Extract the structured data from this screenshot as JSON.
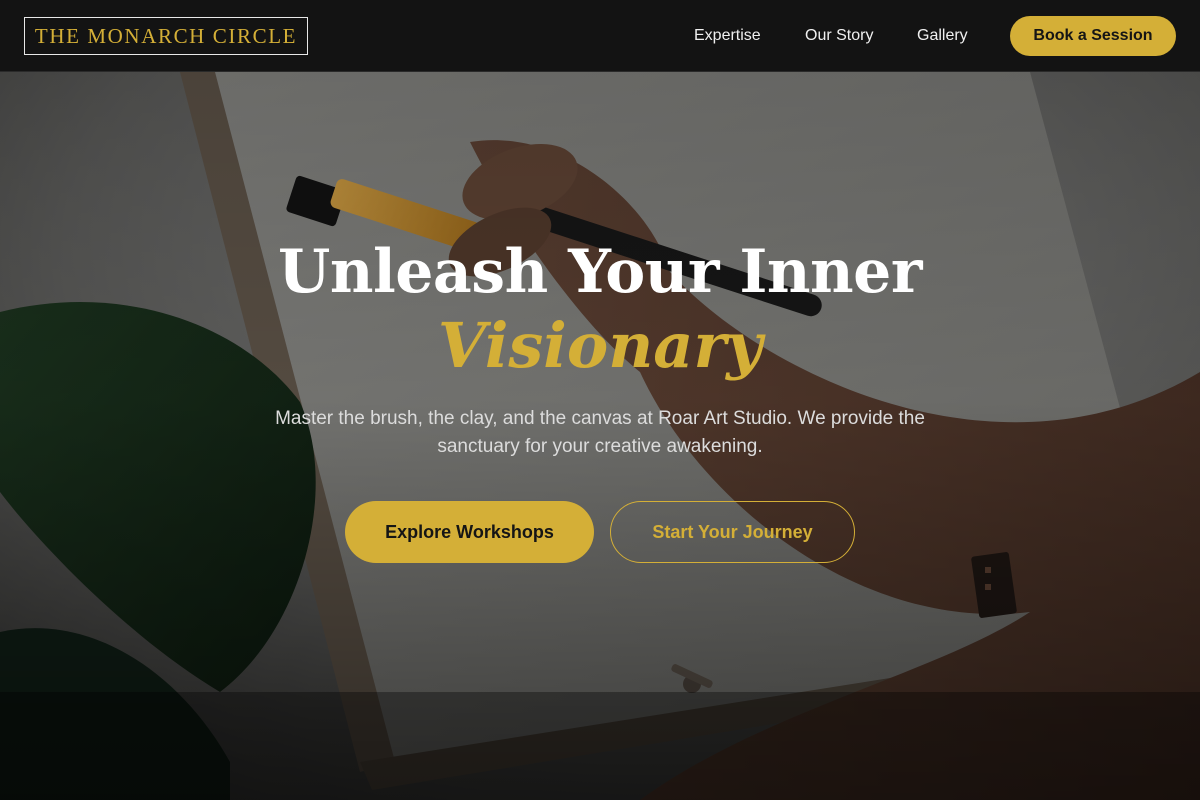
{
  "nav": {
    "brand": "THE MONARCH CIRCLE",
    "links": [
      {
        "label": "Expertise"
      },
      {
        "label": "Our Story"
      },
      {
        "label": "Gallery"
      }
    ],
    "cta_label": "Book a Session"
  },
  "hero": {
    "headline": "Unleash Your Inner",
    "headline_accent": "Visionary",
    "subtitle": "Master the brush, the clay, and the canvas at Roar Art Studio. We provide the sanctuary for your creative awakening.",
    "primary_button": "Explore Workshops",
    "secondary_button": "Start Your Journey",
    "background_image": "painter-hand-with-brush-at-easel"
  },
  "colors": {
    "accent": "#d4af37",
    "nav_bg": "#131313",
    "text_light": "#ffffff",
    "subtitle_text": "#dcdcdc"
  }
}
